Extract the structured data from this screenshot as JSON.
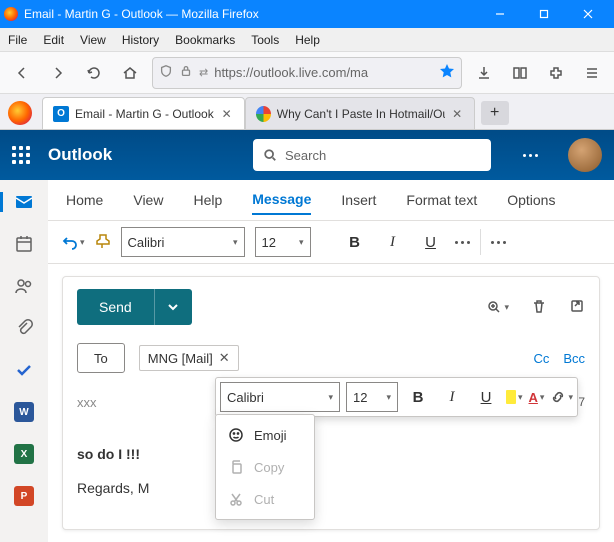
{
  "window": {
    "title": "Email - Martin G - Outlook — Mozilla Firefox"
  },
  "menubar": {
    "file": "File",
    "edit": "Edit",
    "view": "View",
    "history": "History",
    "bookmarks": "Bookmarks",
    "tools": "Tools",
    "help": "Help"
  },
  "url": {
    "text": "https://outlook.live.com/ma"
  },
  "tabs": [
    {
      "label": "Email - Martin G - Outlook"
    },
    {
      "label": "Why Can't I Paste In Hotmail/Outl"
    }
  ],
  "outlook": {
    "brand": "Outlook",
    "search_placeholder": "Search"
  },
  "ribbon_tabs": {
    "home": "Home",
    "view": "View",
    "help": "Help",
    "message": "Message",
    "insert": "Insert",
    "format": "Format text",
    "options": "Options"
  },
  "ribbon": {
    "font": "Calibri",
    "size": "12"
  },
  "compose": {
    "send": "Send",
    "to_label": "To",
    "recipient": "MNG [Mail]",
    "cc": "Cc",
    "bcc": "Bcc",
    "subject": "xxx",
    "draft_status": "Draft saved at 16:17",
    "body_line1": "so do I !!!",
    "body_line2": "Regards, M"
  },
  "floating": {
    "font": "Calibri",
    "size": "12"
  },
  "context_menu": {
    "emoji": "Emoji",
    "copy": "Copy",
    "cut": "Cut"
  }
}
